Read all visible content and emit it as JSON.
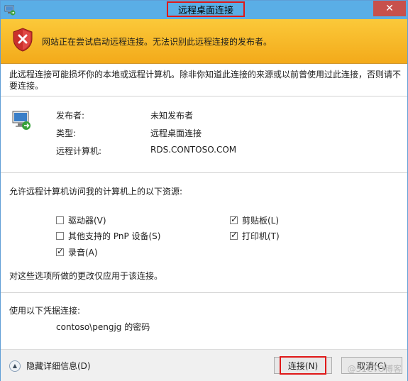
{
  "window": {
    "title": "远程桌面连接",
    "close_glyph": "✕"
  },
  "warning": {
    "text": "网站正在尝试启动远程连接。无法识别此远程连接的发布者。"
  },
  "intro": {
    "text": "此远程连接可能损坏你的本地或远程计算机。除非你知道此连接的来源或以前曾使用过此连接，否则请不要连接。"
  },
  "info": [
    {
      "label": "发布者:",
      "value": "未知发布者"
    },
    {
      "label": "类型:",
      "value": "远程桌面连接"
    },
    {
      "label": "远程计算机:",
      "value": "RDS.CONTOSO.COM"
    }
  ],
  "resources": {
    "heading": "允许远程计算机访问我的计算机上的以下资源:",
    "options": [
      {
        "label": "驱动器(V)",
        "checked": false
      },
      {
        "label": "剪贴板(L)",
        "checked": true
      },
      {
        "label": "其他支持的 PnP 设备(S)",
        "checked": false
      },
      {
        "label": "打印机(T)",
        "checked": true
      },
      {
        "label": "录音(A)",
        "checked": true
      }
    ],
    "note": "对这些选项所做的更改仅应用于该连接。"
  },
  "credentials": {
    "heading": "使用以下凭据连接:",
    "value": "contoso\\pengjg 的密码"
  },
  "footer": {
    "details_label": "隐藏详细信息(D)",
    "connect_label": "连接(N)",
    "cancel_label": "取消(C)",
    "watermark": "@51CTO博客"
  },
  "colors": {
    "titlebar": "#5aaee6",
    "warning_banner": "#f7b728",
    "highlight_border": "#e01818",
    "close_button": "#c7514c"
  }
}
